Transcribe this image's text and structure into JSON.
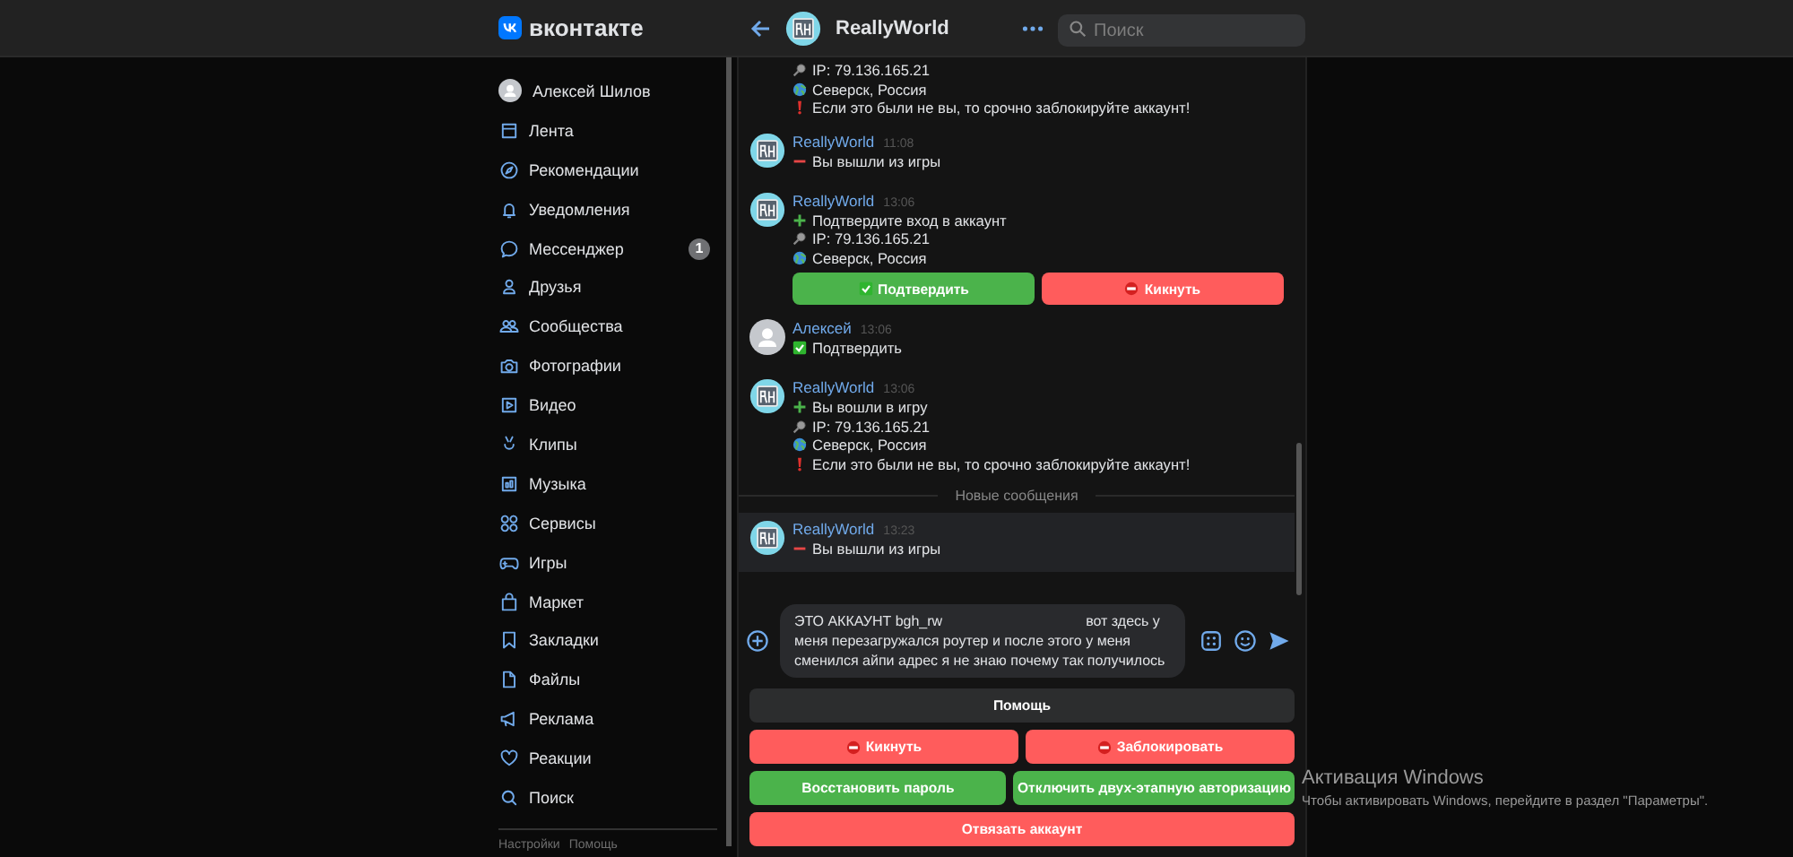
{
  "header": {
    "logo_text": "вконтакте",
    "chat_title": "ReallyWorld",
    "search": {
      "placeholder": "Поиск"
    }
  },
  "sidebar": {
    "profile": {
      "name": "Алексей Шилов"
    },
    "items": [
      {
        "label": "Лента"
      },
      {
        "label": "Рекомендации"
      },
      {
        "label": "Уведомления"
      },
      {
        "label": "Мессенджер",
        "badge": "1"
      },
      {
        "label": "Друзья"
      },
      {
        "label": "Сообщества"
      },
      {
        "label": "Фотографии"
      },
      {
        "label": "Видео"
      },
      {
        "label": "Клипы"
      },
      {
        "label": "Музыка"
      },
      {
        "label": "Сервисы"
      },
      {
        "label": "Игры"
      },
      {
        "label": "Маркет"
      },
      {
        "label": "Закладки"
      },
      {
        "label": "Файлы"
      },
      {
        "label": "Реклама"
      },
      {
        "label": "Реакции"
      },
      {
        "label": "Поиск"
      }
    ],
    "footer_links": [
      "Настройки",
      "Помощь"
    ]
  },
  "messages": [
    {
      "kind": "continuation",
      "unread": false,
      "lines": [
        {
          "kind": "ip",
          "text": "IP: 79.136.165.21"
        },
        {
          "kind": "globe",
          "text": "Северск, Россия"
        },
        {
          "kind": "alert",
          "text": "Если это были не вы, то срочно заблокируйте аккаунт!"
        }
      ]
    },
    {
      "kind": "bot",
      "author": "ReallyWorld",
      "time": "11:08",
      "unread": false,
      "lines": [
        {
          "kind": "minus",
          "text": "Вы вышли из игры"
        }
      ]
    },
    {
      "kind": "bot",
      "author": "ReallyWorld",
      "time": "13:06",
      "unread": false,
      "lines": [
        {
          "kind": "plus",
          "text": "Подтвердите вход в аккаунт"
        },
        {
          "kind": "ip",
          "text": "IP: 79.136.165.21"
        },
        {
          "kind": "globe",
          "text": "Северск, Россия"
        }
      ],
      "buttons": [
        {
          "label": "Подтвердить",
          "color": "#4bb34b",
          "kind": "check"
        },
        {
          "label": "Кикнуть",
          "color": "#ff5c5c",
          "kind": "stop"
        }
      ]
    },
    {
      "kind": "user",
      "author": "Алексей",
      "time": "13:06",
      "unread": false,
      "lines": [
        {
          "kind": "check",
          "text": "Подтвердить"
        }
      ]
    },
    {
      "kind": "bot",
      "author": "ReallyWorld",
      "time": "13:06",
      "unread": false,
      "lines": [
        {
          "kind": "plus",
          "text": "Вы вошли в игру"
        },
        {
          "kind": "ip",
          "text": "IP: 79.136.165.21"
        },
        {
          "kind": "globe",
          "text": "Северск, Россия"
        },
        {
          "kind": "alert",
          "text": "Если это были не вы, то срочно заблокируйте аккаунт!"
        }
      ]
    },
    {
      "kind": "divider",
      "text": "Новые сообщения"
    },
    {
      "kind": "bot",
      "author": "ReallyWorld",
      "time": "13:23",
      "unread": true,
      "lines": [
        {
          "kind": "minus",
          "text": "Вы вышли из игры"
        }
      ]
    }
  ],
  "composer": {
    "value": "ЭТО АККАУНТ bgh_rw                                    вот здесь у меня перезагружался роутер и после этого у меня сменился айпи адрес я не знаю почему так получилось"
  },
  "keyboard": [
    [
      {
        "label": "Помощь",
        "color": "#2c2d2e",
        "kind": "plain"
      }
    ],
    [
      {
        "label": "Кикнуть",
        "color": "#ff5c5c",
        "kind": "stop"
      },
      {
        "label": "Заблокировать",
        "color": "#ff5c5c",
        "kind": "stop"
      }
    ],
    [
      {
        "label": "Восстановить пароль",
        "color": "#4bb34b",
        "kind": "plain"
      },
      {
        "label": "Отключить двух-этапную авторизацию",
        "color": "#4bb34b",
        "kind": "plain"
      }
    ],
    [
      {
        "label": "Отвязать аккаунт",
        "color": "#ff5c5c",
        "kind": "plain"
      }
    ]
  ],
  "os_notice": {
    "title": "Активация Windows",
    "text": "Чтобы активировать Windows, перейдите в раздел \"Параметры\"."
  }
}
